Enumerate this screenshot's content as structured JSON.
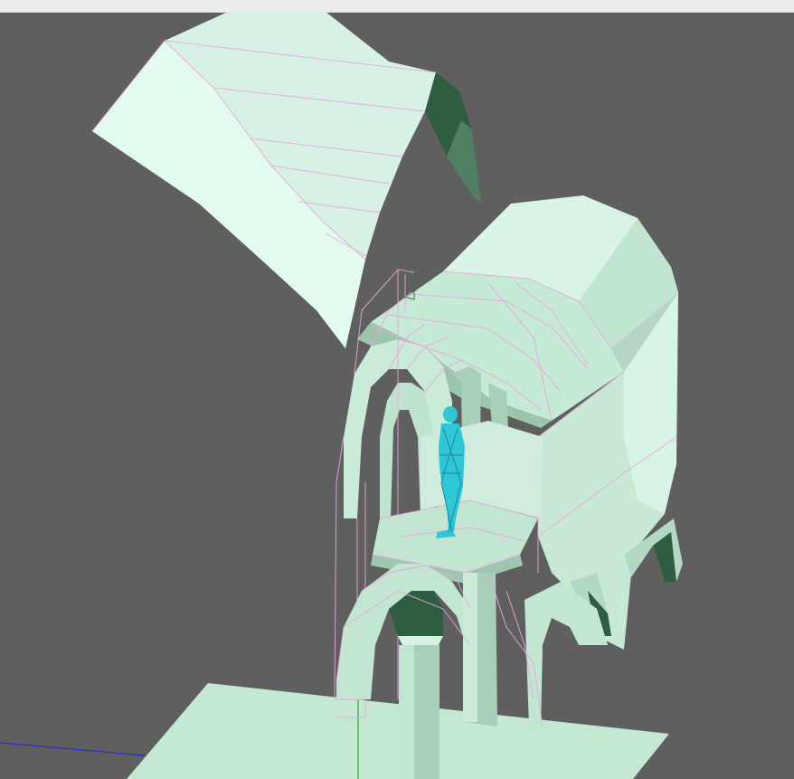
{
  "viewport": {
    "background": "#5f5f5f",
    "surface_colors": {
      "light": "#d9f3e6",
      "mid": "#bfe3cf",
      "dark": "#8db39c",
      "deep": "#2f5d42"
    },
    "wireframe_color": "#e9a6dd",
    "figure_color": "#2fc6d6"
  }
}
